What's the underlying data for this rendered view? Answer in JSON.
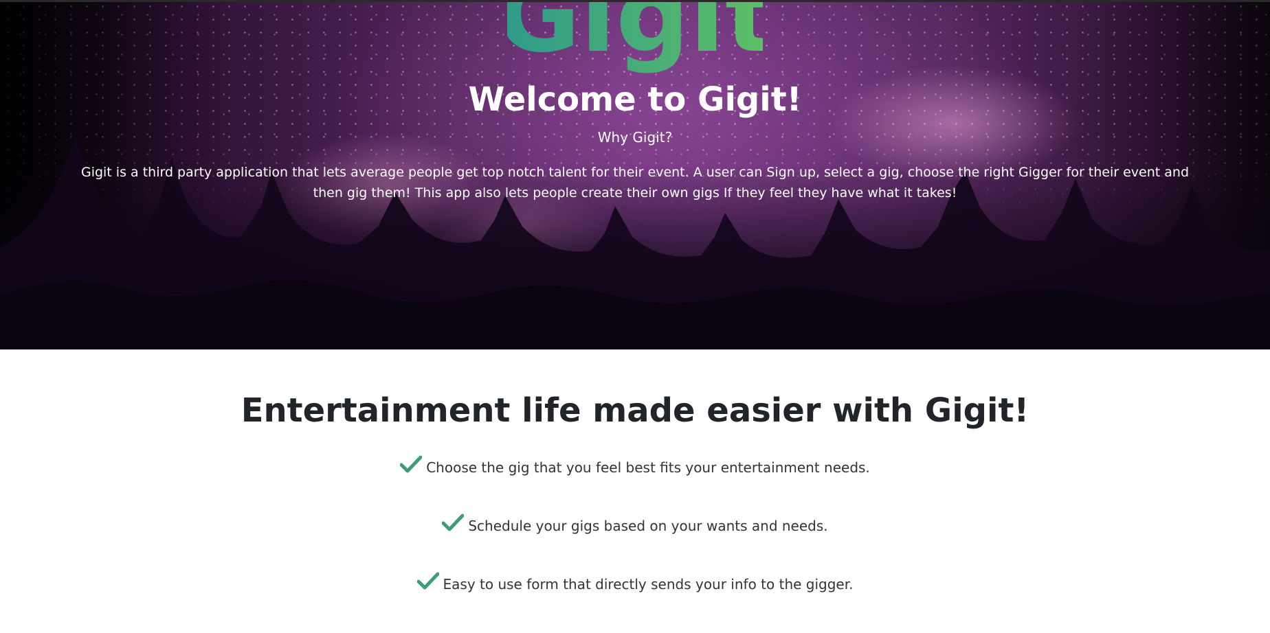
{
  "hero": {
    "logo_text": "Gigit",
    "title": "Welcome to Gigit!",
    "subtitle": "Why Gigit?",
    "description": "Gigit is a third party application that lets average people get top notch talent for their event. A user can Sign up, select a gig, choose the right Gigger for their event and then gig them! This app also lets people create their own gigs If they feel they have what it takes!"
  },
  "features": {
    "title": "Entertainment life made easier with Gigit!",
    "items": [
      {
        "icon": "check-icon",
        "text": "Choose the gig that you feel best fits your entertainment needs."
      },
      {
        "icon": "check-icon",
        "text": "Schedule your gigs based on your wants and needs."
      },
      {
        "icon": "check-icon",
        "text": "Easy to use form that directly sends your info to the gigger."
      }
    ]
  },
  "colors": {
    "brand_green": "#4caf6e",
    "brand_teal": "#2e9a8a",
    "check_color": "#3e9b7b",
    "heading_text": "#212529",
    "hero_purple": "#5b2a64"
  }
}
